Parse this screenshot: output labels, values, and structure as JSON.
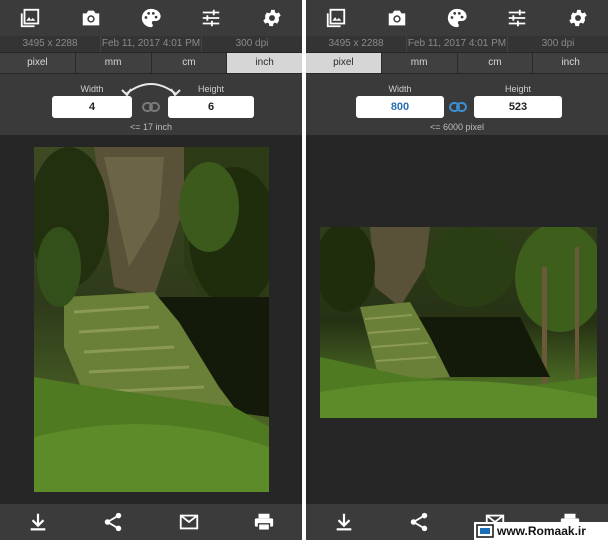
{
  "left": {
    "info": {
      "pixels": "3495 x 2288",
      "date": "Feb 11, 2017 4:01 PM",
      "dpi": "300 dpi"
    },
    "units": [
      "pixel",
      "mm",
      "cm",
      "inch"
    ],
    "active_unit": "inch",
    "width_label": "Width",
    "height_label": "Height",
    "width_value": "4",
    "height_value": "6",
    "limit_text": "<= 17 inch"
  },
  "right": {
    "info": {
      "pixels": "3495 x 2288",
      "date": "Feb 11, 2017 4:01 PM",
      "dpi": "300 dpi"
    },
    "units": [
      "pixel",
      "mm",
      "cm",
      "inch"
    ],
    "active_unit": "pixel",
    "width_label": "Width",
    "height_label": "Height",
    "width_value": "800",
    "height_value": "523",
    "limit_text": "<= 6000 pixel"
  },
  "toolbar_icons": [
    "gallery-icon",
    "camera-icon",
    "palette-icon",
    "sliders-icon",
    "gear-icon"
  ],
  "bottom_icons": [
    "download-icon",
    "share-icon",
    "mail-icon",
    "print-icon"
  ],
  "watermark": {
    "text": "www.Romaak.ir"
  },
  "colors": {
    "panel_bg": "#262626",
    "bar_bg": "#3b3b3b",
    "active_unit_bg": "#d6d6d6",
    "link_icon": "#3a8fd6",
    "pixel_value": "#2a6fb3"
  }
}
